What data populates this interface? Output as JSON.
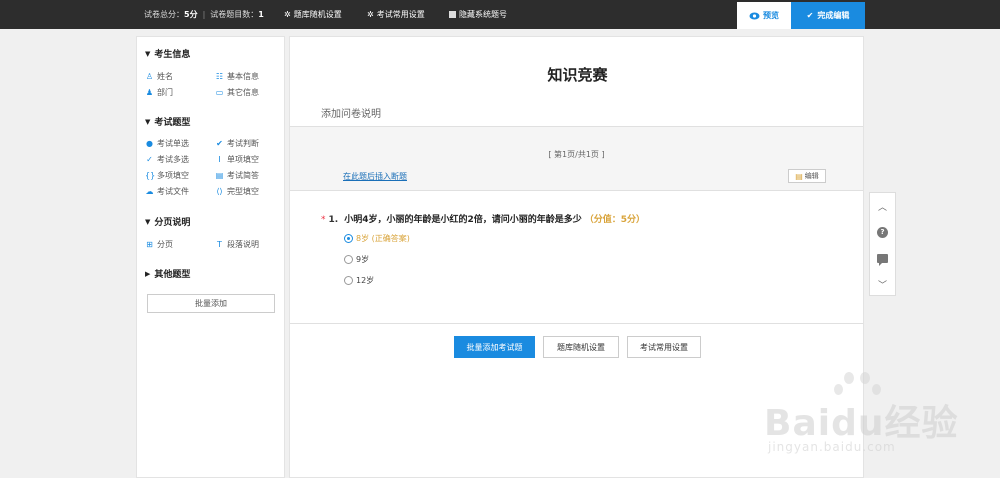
{
  "topbar": {
    "total_score_label": "试卷总分：",
    "total_score": "5分",
    "separator": "|",
    "question_count_label": "试卷题目数：",
    "question_count": "1",
    "links": [
      {
        "icon": "gear-icon",
        "label": "题库随机设置"
      },
      {
        "icon": "gear-icon",
        "label": "考试常用设置"
      },
      {
        "icon": "checkbox-icon",
        "label": "隐藏系统题号"
      }
    ],
    "preview_label": "预览",
    "done_label": "完成编辑"
  },
  "sidebar": {
    "sections": [
      {
        "title": "考生信息",
        "items": [
          {
            "icon": "person-icon",
            "label": "姓名"
          },
          {
            "icon": "id-card-icon",
            "label": "基本信息"
          },
          {
            "icon": "group-icon",
            "label": "部门"
          },
          {
            "icon": "card-icon",
            "label": "其它信息"
          }
        ]
      },
      {
        "title": "考试题型",
        "items": [
          {
            "icon": "dot-icon",
            "label": "考试单选"
          },
          {
            "icon": "double-check-icon",
            "label": "考试判断"
          },
          {
            "icon": "check-icon",
            "label": "考试多选"
          },
          {
            "icon": "cursor-icon",
            "label": "单项填空"
          },
          {
            "icon": "braces-icon",
            "label": "多项填空"
          },
          {
            "icon": "document-icon",
            "label": "考试简答"
          },
          {
            "icon": "cloud-upload-icon",
            "label": "考试文件"
          },
          {
            "icon": "bracket-icon",
            "label": "完型填空"
          }
        ]
      },
      {
        "title": "分页说明",
        "items": [
          {
            "icon": "page-icon",
            "label": "分页"
          },
          {
            "icon": "text-icon",
            "label": "段落说明"
          }
        ]
      },
      {
        "title": "其他题型",
        "items": []
      }
    ],
    "batch_add_label": "批量添加"
  },
  "main": {
    "title": "知识竞赛",
    "description": "添加问卷说明",
    "page_indicator": "[ 第1页/共1页 ]",
    "insert_break_link": "在此题后插入断题",
    "edit_label": "编辑",
    "question": {
      "required_mark": "*",
      "number": "1.",
      "text": "小明4岁，小丽的年龄是小红的2倍，请问小丽的年龄是多少",
      "score": "（分值：5分）",
      "options": [
        {
          "label": "8岁 (正确答案)",
          "selected": true
        },
        {
          "label": "9岁",
          "selected": false
        },
        {
          "label": "12岁",
          "selected": false
        }
      ]
    },
    "bottom_buttons": [
      "批量添加考试题",
      "题库随机设置",
      "考试常用设置"
    ]
  },
  "float_bar": [
    "chevron-up-icon",
    "help-icon",
    "message-icon",
    "chevron-down-icon"
  ],
  "watermark": {
    "brand": "Baidu经验",
    "url": "jingyan.baidu.com"
  },
  "colors": {
    "accent": "#1a8be0",
    "score": "#d9a43b",
    "topbar": "#2d2d2d"
  }
}
